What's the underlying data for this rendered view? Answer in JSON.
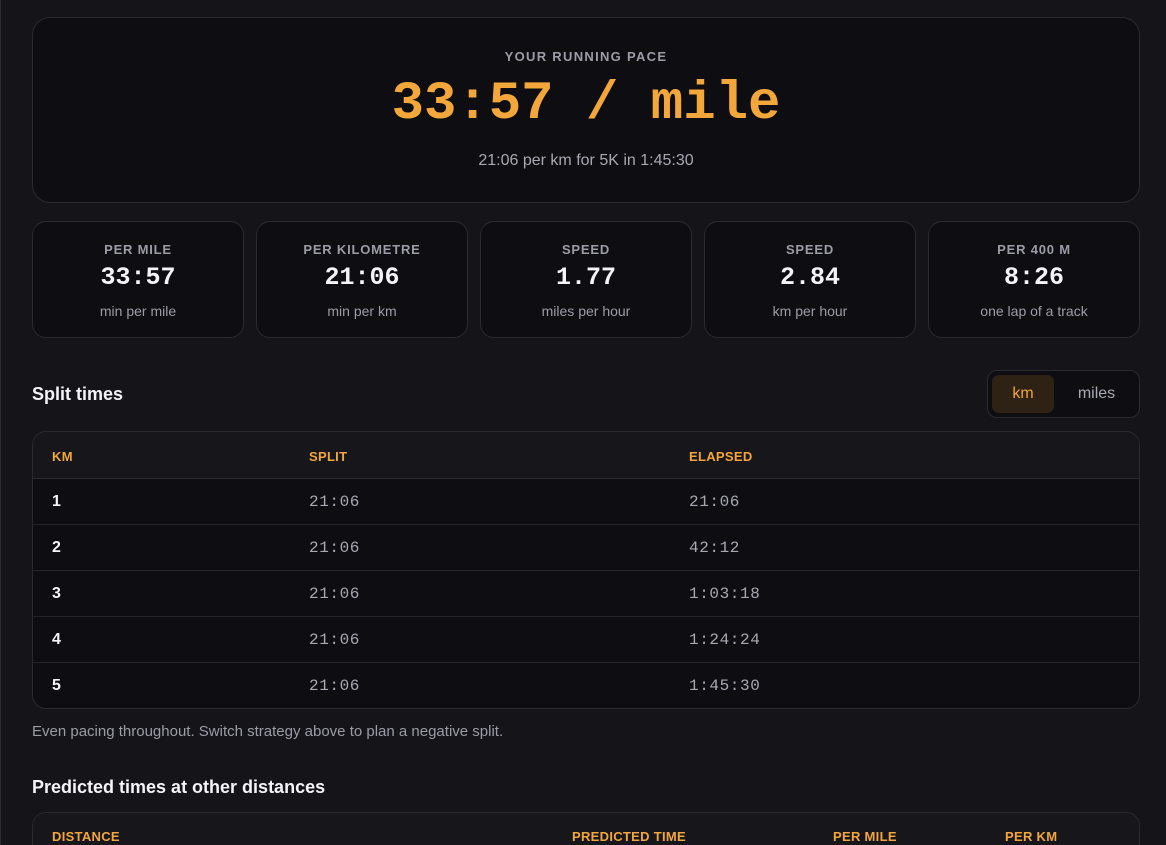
{
  "hero": {
    "eyebrow": "YOUR RUNNING PACE",
    "pace": "33:57 / mile",
    "subtitle": "21:06 per km for 5K in 1:45:30"
  },
  "stats": [
    {
      "label": "PER MILE",
      "value": "33:57",
      "unit": "min per mile"
    },
    {
      "label": "PER KILOMETRE",
      "value": "21:06",
      "unit": "min per km"
    },
    {
      "label": "SPEED",
      "value": "1.77",
      "unit": "miles per hour"
    },
    {
      "label": "SPEED",
      "value": "2.84",
      "unit": "km per hour"
    },
    {
      "label": "PER 400 M",
      "value": "8:26",
      "unit": "one lap of a track"
    }
  ],
  "splits": {
    "title": "Split times",
    "toggle": {
      "km": "km",
      "miles": "miles",
      "selected": "km"
    },
    "columns": [
      "KM",
      "SPLIT",
      "ELAPSED"
    ],
    "rows": [
      {
        "km": "1",
        "split": "21:06",
        "elapsed": "21:06"
      },
      {
        "km": "2",
        "split": "21:06",
        "elapsed": "42:12"
      },
      {
        "km": "3",
        "split": "21:06",
        "elapsed": "1:03:18"
      },
      {
        "km": "4",
        "split": "21:06",
        "elapsed": "1:24:24"
      },
      {
        "km": "5",
        "split": "21:06",
        "elapsed": "1:45:30"
      }
    ],
    "note": "Even pacing throughout. Switch strategy above to plan a negative split."
  },
  "predicted": {
    "title": "Predicted times at other distances",
    "columns": [
      "DISTANCE",
      "PREDICTED TIME",
      "PER MILE",
      "PER KM"
    ]
  },
  "colors": {
    "accent": "#f3a63a",
    "background": "#141419",
    "card": "#0e0e12"
  }
}
